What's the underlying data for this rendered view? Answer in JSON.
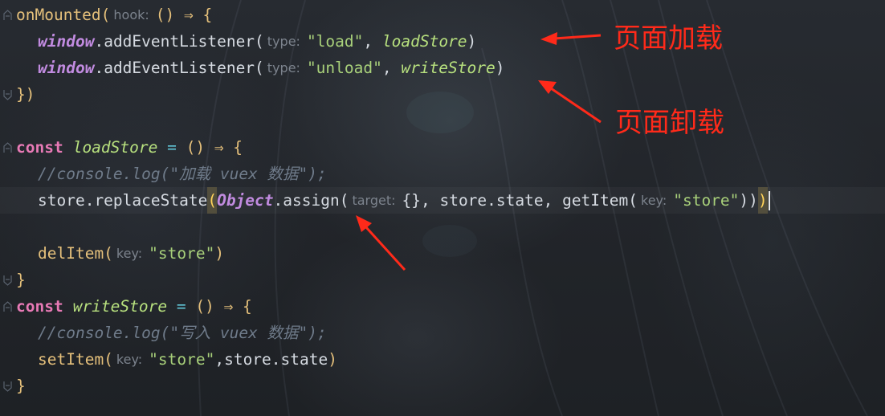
{
  "editor": {
    "lines": [
      {
        "kind": "mounted",
        "t1": "onMounted(",
        "hint": "hook:",
        "t2": "() ⇒ {"
      },
      {
        "kind": "listener1",
        "win": "window",
        "dot": ".",
        "fn": "addEventListener(",
        "hint": "type:",
        "str": "\"load\"",
        "comma": ", ",
        "arg": "loadStore",
        "close": ")"
      },
      {
        "kind": "listener2",
        "win": "window",
        "dot": ".",
        "fn": "addEventListener(",
        "hint": "type:",
        "str": "\"unload\"",
        "comma": ", ",
        "arg": "writeStore",
        "close": ")"
      },
      {
        "kind": "close",
        "t": "})"
      },
      {
        "kind": "blank"
      },
      {
        "kind": "const1",
        "kw": "const",
        "name": "loadStore",
        "eq": " = ",
        "rest": "() ⇒ {"
      },
      {
        "kind": "comment1",
        "t": "//console.log(\"加载 vuex 数据\");"
      },
      {
        "kind": "replace",
        "a": "store.replaceState",
        "p1": "(",
        "obj": "Object",
        "b": ".assign(",
        "hint1": "target:",
        "c": "{}, store.state, getItem(",
        "hint2": "key:",
        "str": "\"store\"",
        "d": "))",
        "p2": ")"
      },
      {
        "kind": "blank"
      },
      {
        "kind": "del",
        "fn": "delItem(",
        "hint": "key:",
        "str": "\"store\"",
        "close": ")"
      },
      {
        "kind": "close",
        "t": "}"
      },
      {
        "kind": "const2",
        "kw": "const",
        "name": "writeStore",
        "eq": " = ",
        "rest": "() ⇒ {"
      },
      {
        "kind": "comment2",
        "t": "//console.log(\"写入 vuex 数据\");"
      },
      {
        "kind": "set",
        "fn": "setItem(",
        "hint": "key:",
        "str": "\"store\"",
        "rest": ",store.state",
        "close": ")"
      },
      {
        "kind": "close",
        "t": "}"
      }
    ]
  },
  "annotations": {
    "load_note": "页面加载",
    "unload_note": "页面卸载",
    "color": "#ff2a1a"
  },
  "colors": {
    "keyword": "#e87ab6",
    "function": "#e5c07b",
    "string": "#a8d07a",
    "comment": "#6f7b8a",
    "object": "#c18be0",
    "hint": "#7c838d"
  }
}
